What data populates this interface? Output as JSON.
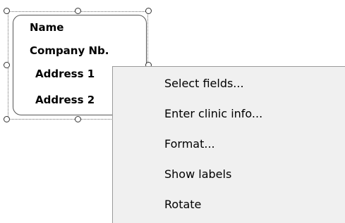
{
  "address_box": {
    "fields": [
      "Name",
      "Company Nb.",
      "Address 1",
      "Address 2"
    ]
  },
  "context_menu": {
    "items": [
      {
        "label": "Select fields..."
      },
      {
        "label": "Enter clinic info..."
      },
      {
        "label": "Format..."
      },
      {
        "label": "Show labels"
      },
      {
        "label": "Rotate"
      }
    ]
  }
}
